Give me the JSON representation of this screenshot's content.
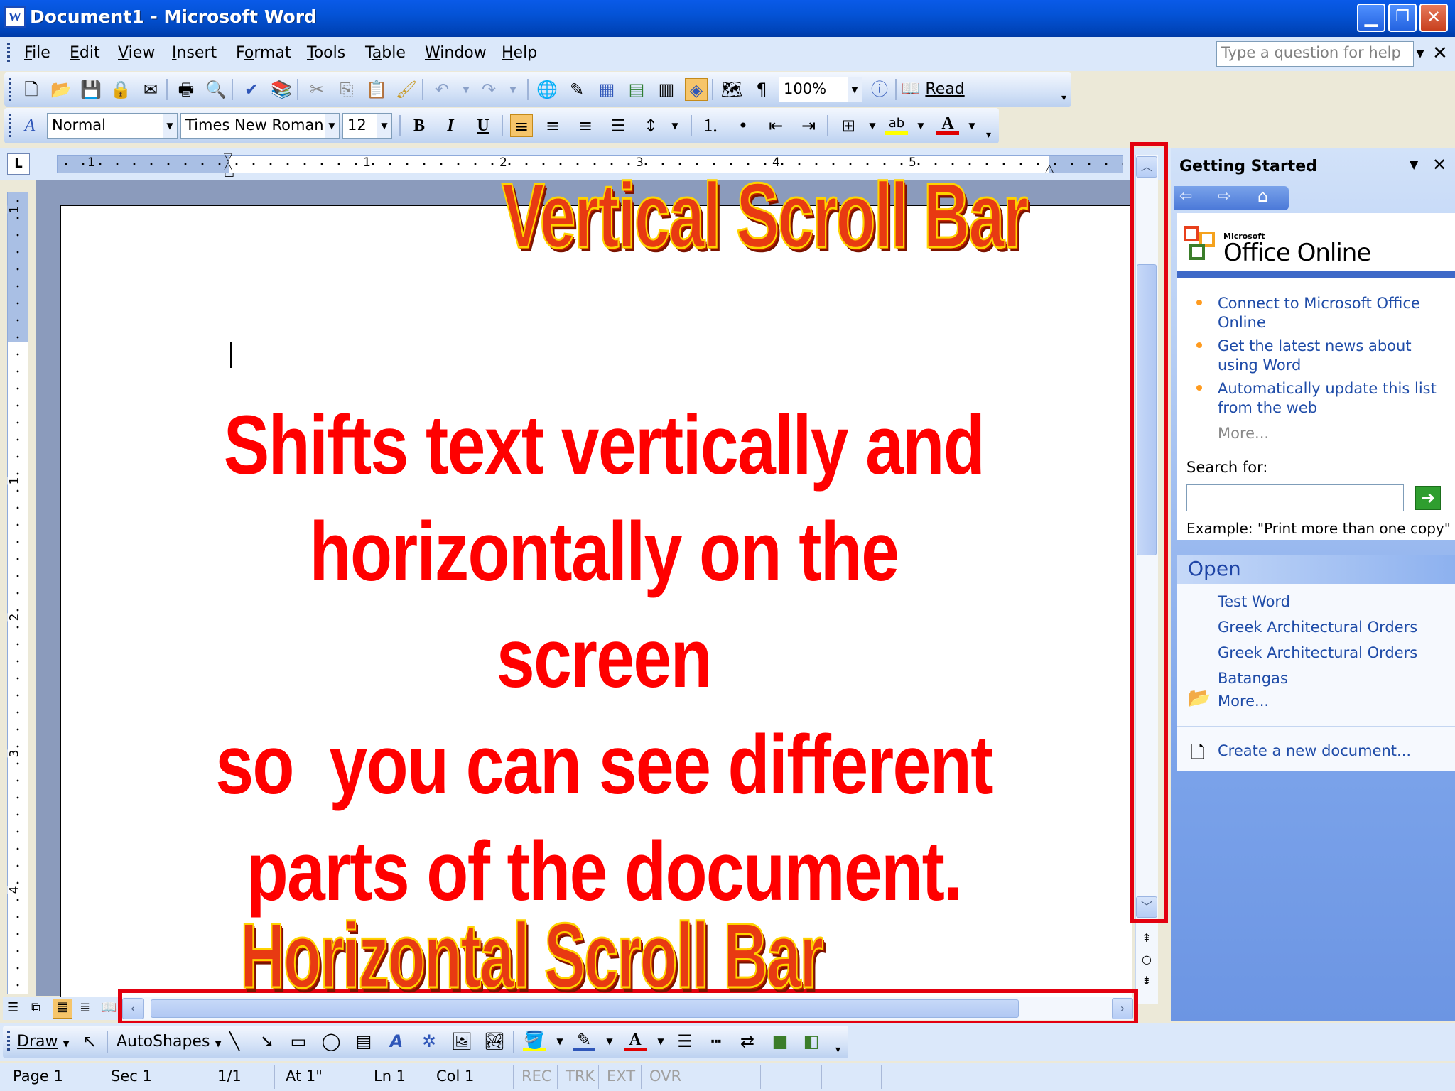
{
  "window": {
    "title": "Document1 - Microsoft Word",
    "app_icon": "word-app-icon",
    "min_glyph": "▁",
    "max_glyph": "❐",
    "close_glyph": "✕"
  },
  "menu": {
    "items": [
      {
        "label": "File",
        "key": "F"
      },
      {
        "label": "Edit",
        "key": "E"
      },
      {
        "label": "View",
        "key": "V"
      },
      {
        "label": "Insert",
        "key": "I"
      },
      {
        "label": "Format",
        "key": "o"
      },
      {
        "label": "Tools",
        "key": "T"
      },
      {
        "label": "Table",
        "key": "a"
      },
      {
        "label": "Window",
        "key": "W"
      },
      {
        "label": "Help",
        "key": "H"
      }
    ],
    "help_placeholder": "Type a question for help",
    "close_glyph": "✕"
  },
  "standard_toolbar": {
    "zoom": "100%",
    "read_label": "Read",
    "pilcrow": "¶"
  },
  "formatting_toolbar": {
    "style": "Normal",
    "font": "Times New Roman",
    "size": "12",
    "bold": "B",
    "italic": "I",
    "underline": "U",
    "highlight_text": "ab",
    "font_color_letter": "A"
  },
  "ruler": {
    "marks": [
      "1",
      "1",
      "2",
      "3",
      "4",
      "5"
    ],
    "vmarks": [
      "1",
      "1",
      "2",
      "3",
      "4"
    ],
    "tab_glyph": "L"
  },
  "document": {
    "lines": [
      "Shifts text vertically and",
      "horizontally on the screen",
      "so  you can see different",
      "parts of the document."
    ]
  },
  "annotations": {
    "vertical": "Vertical Scroll Bar",
    "horizontal": "Horizontal Scroll Bar",
    "box_color": "#e3000f",
    "text_color": "#e83a12",
    "text_outline": "#ffd300"
  },
  "task_pane": {
    "title": "Getting Started",
    "office_online_small": "Microsoft",
    "office_online": "Office Online",
    "links": [
      "Connect to Microsoft Office Online",
      "Get the latest news about using Word",
      "Automatically update this list from the web"
    ],
    "more": "More...",
    "search_label": "Search for:",
    "example": "Example:  \"Print more than one copy\"",
    "open_title": "Open",
    "open_files": [
      "Test Word",
      "Greek Architectural Orders",
      "Greek Architectural Orders",
      "Batangas"
    ],
    "open_more": "More...",
    "create_new": "Create a new document..."
  },
  "drawing_toolbar": {
    "draw": "Draw",
    "autoshapes": "AutoShapes",
    "font_color_letter": "A"
  },
  "status_bar": {
    "page": "Page  1",
    "sec": "Sec  1",
    "pages": "1/1",
    "at": "At  1\"",
    "ln": "Ln  1",
    "col": "Col  1",
    "rec": "REC",
    "trk": "TRK",
    "ext": "EXT",
    "ovr": "OVR"
  }
}
